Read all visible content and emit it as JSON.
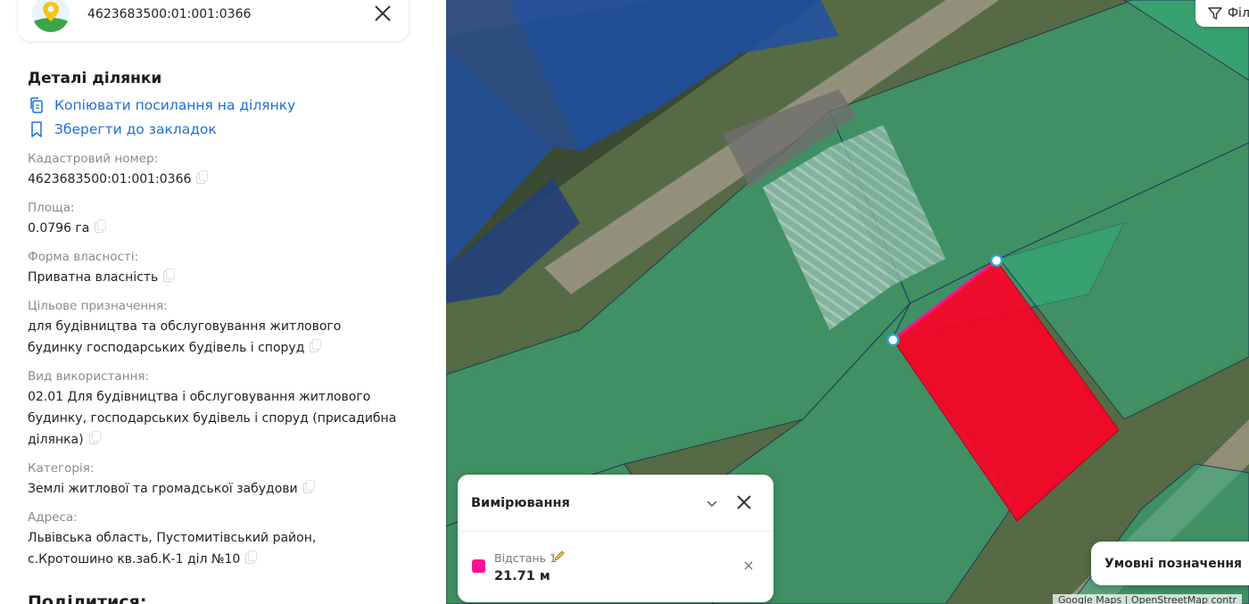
{
  "search": {
    "query": "4623683500:01:001:0366"
  },
  "details": {
    "title": "Деталі ділянки",
    "copy_link_label": "Копіювати посилання на ділянку",
    "bookmark_label": "Зберегти до закладок",
    "fields": [
      {
        "label": "Кадастровий номер:",
        "value": "4623683500:01:001:0366"
      },
      {
        "label": "Площа:",
        "value": "0.0796 га"
      },
      {
        "label": "Форма власності:",
        "value": "Приватна власність"
      },
      {
        "label": "Цільове призначення:",
        "value": "для будівництва та обслуговування житлового будинку господарських будівель і споруд"
      },
      {
        "label": "Вид використання:",
        "value": "02.01 Для будівництва і обслуговування житлового будинку, господарських будівель і споруд (присадибна ділянка)"
      },
      {
        "label": "Категорія:",
        "value": "Землі житлової та громадської забудови"
      },
      {
        "label": "Адреса:",
        "value": "Львівська область, Пустомитівський район, с.Кротошино кв.заб.К-1 діл №10"
      }
    ],
    "share_title": "Поділитися:"
  },
  "map": {
    "filter_label": "Філ",
    "measurement": {
      "title": "Вимірювання",
      "item_label": "Відстань 1",
      "item_value": "21.71 м",
      "color": "#ff0f8f"
    },
    "legend_label": "Умовні позначення",
    "attribution": "Google Maps | OpenStreetMap contr",
    "colors": {
      "parcel_selected": "#ff0026",
      "parcels": "#2fae7c",
      "parcels_other": "#1e58b8"
    }
  }
}
